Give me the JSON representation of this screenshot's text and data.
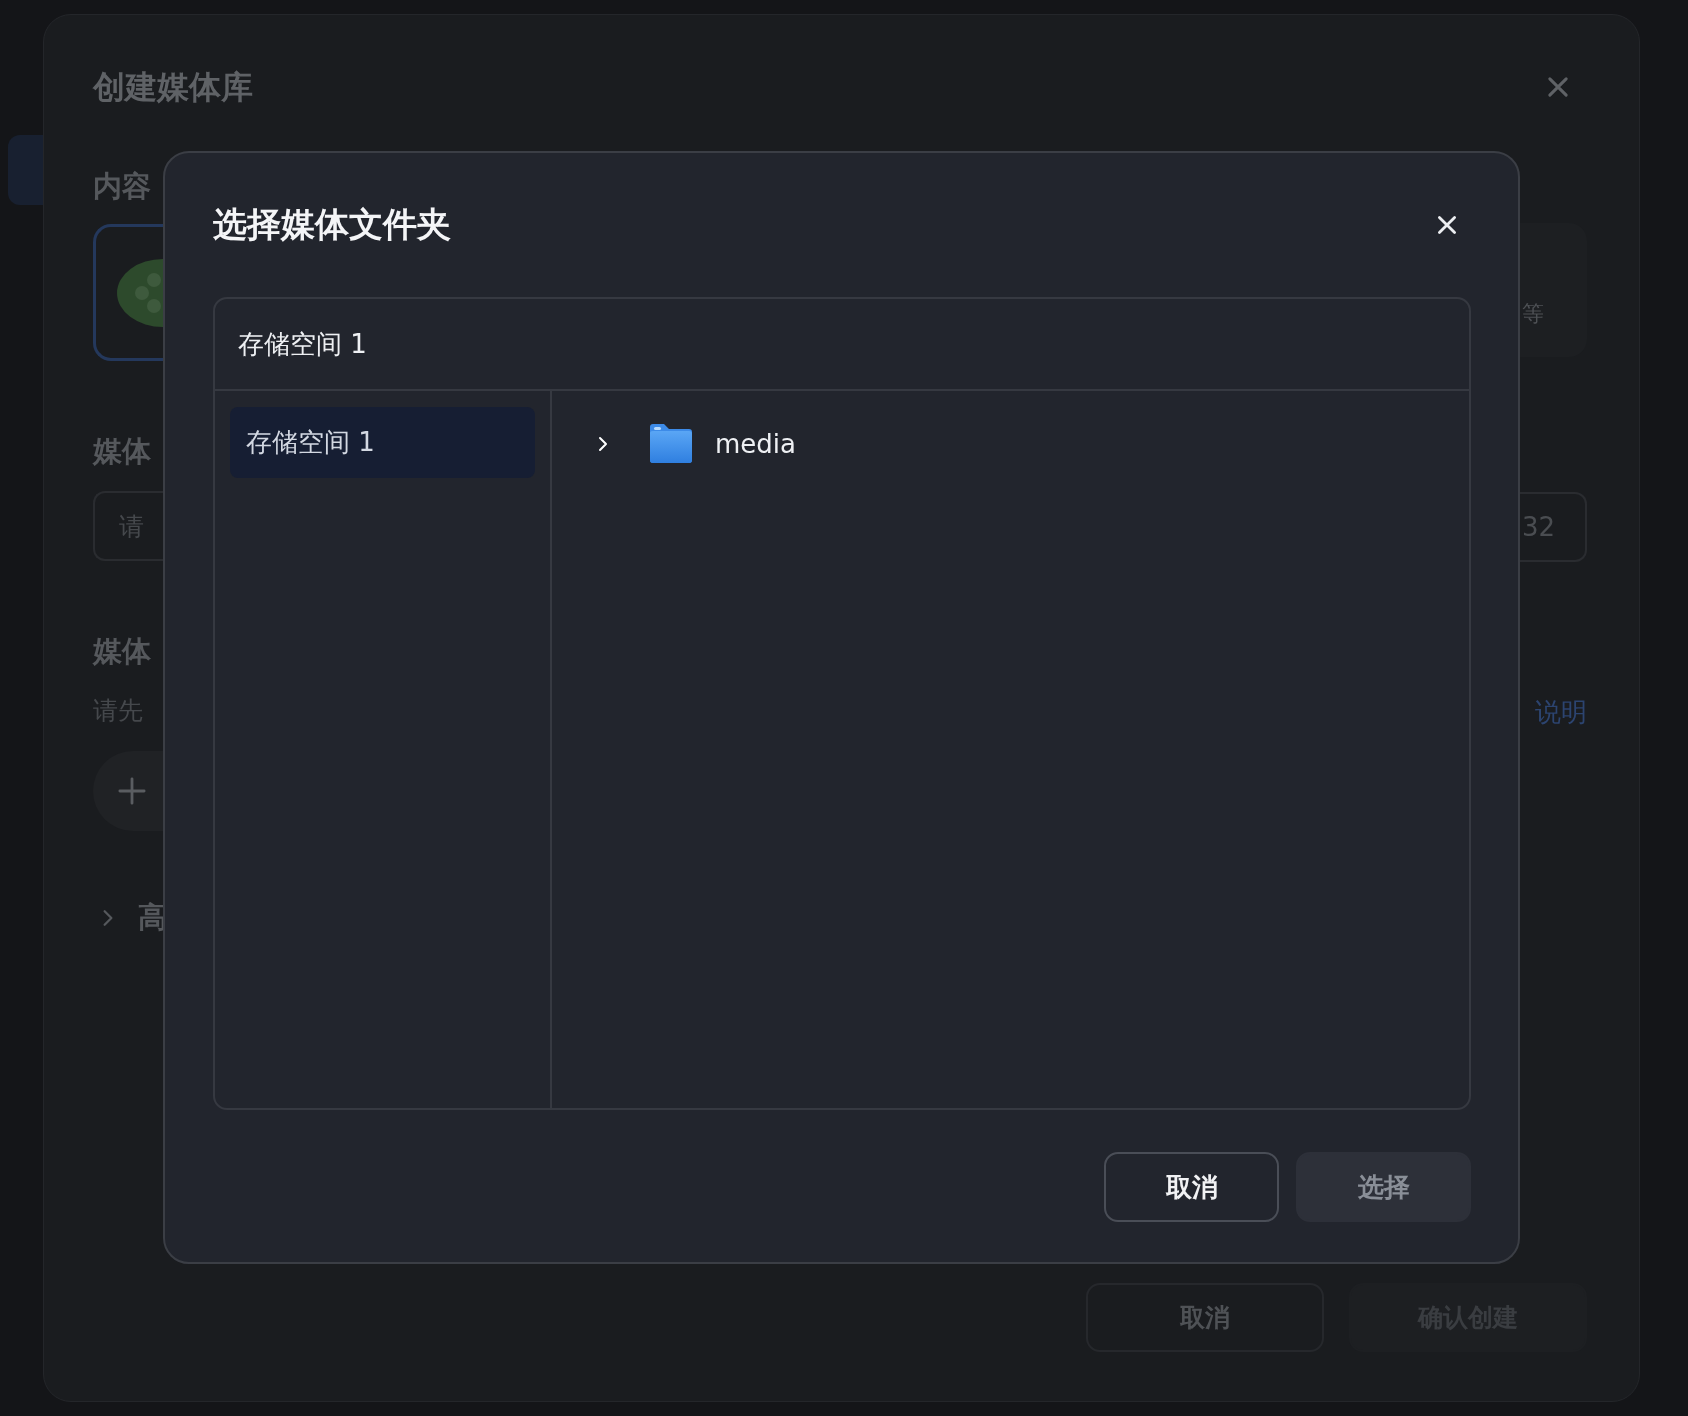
{
  "background_dialog": {
    "title": "创建媒体库",
    "content_type": {
      "label": "内容",
      "card_text": "等"
    },
    "name": {
      "label": "媒体",
      "placeholder": "请",
      "counter": "32"
    },
    "folders": {
      "label": "媒体",
      "hint": "请先",
      "help_link": "说明"
    },
    "advanced": {
      "label": "高",
      "expanded": false
    },
    "buttons": [
      {
        "label": "取消",
        "kind": "secondary",
        "disabled": false
      },
      {
        "label": "确认创建",
        "kind": "primary",
        "disabled": true
      }
    ]
  },
  "dialog": {
    "title": "选择媒体文件夹",
    "path": "存储空间 1",
    "locations": [
      {
        "label": "存储空间 1",
        "selected": true
      }
    ],
    "folders": [
      {
        "name": "media",
        "expanded": false
      }
    ],
    "buttons": [
      {
        "label": "取消",
        "kind": "secondary",
        "disabled": false
      },
      {
        "label": "选择",
        "kind": "primary",
        "disabled": true
      }
    ]
  }
}
